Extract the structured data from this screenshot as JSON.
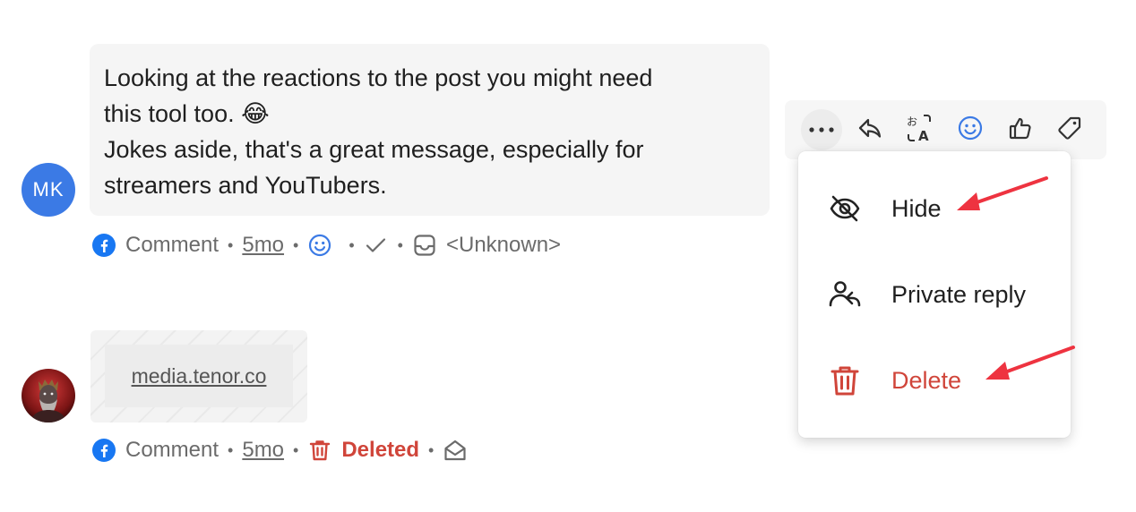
{
  "comments": [
    {
      "avatar_initials": "MK",
      "text_lines": [
        "Looking at the reactions to the post you might need",
        "this tool too. 😂",
        "Jokes aside, that's a great message, especially for",
        "streamers and YouTubers."
      ],
      "source": "Comment",
      "time": "5mo",
      "status_label": "<Unknown>"
    },
    {
      "media_link": "media.tenor.co",
      "source": "Comment",
      "time": "5mo",
      "status_label": "Deleted"
    }
  ],
  "toolbar": {
    "icons": [
      "more-icon",
      "reply-icon",
      "translate-icon",
      "emoji-icon",
      "like-icon",
      "tag-icon"
    ]
  },
  "menu": {
    "items": [
      {
        "label": "Hide",
        "icon": "eye-off-icon"
      },
      {
        "label": "Private reply",
        "icon": "private-reply-icon"
      },
      {
        "label": "Delete",
        "icon": "trash-icon"
      }
    ]
  },
  "colors": {
    "avatar": "#3b7ae5",
    "accent_blue": "#3b7ae5",
    "danger": "#d0453a",
    "annotation_arrow": "#ee3340"
  }
}
